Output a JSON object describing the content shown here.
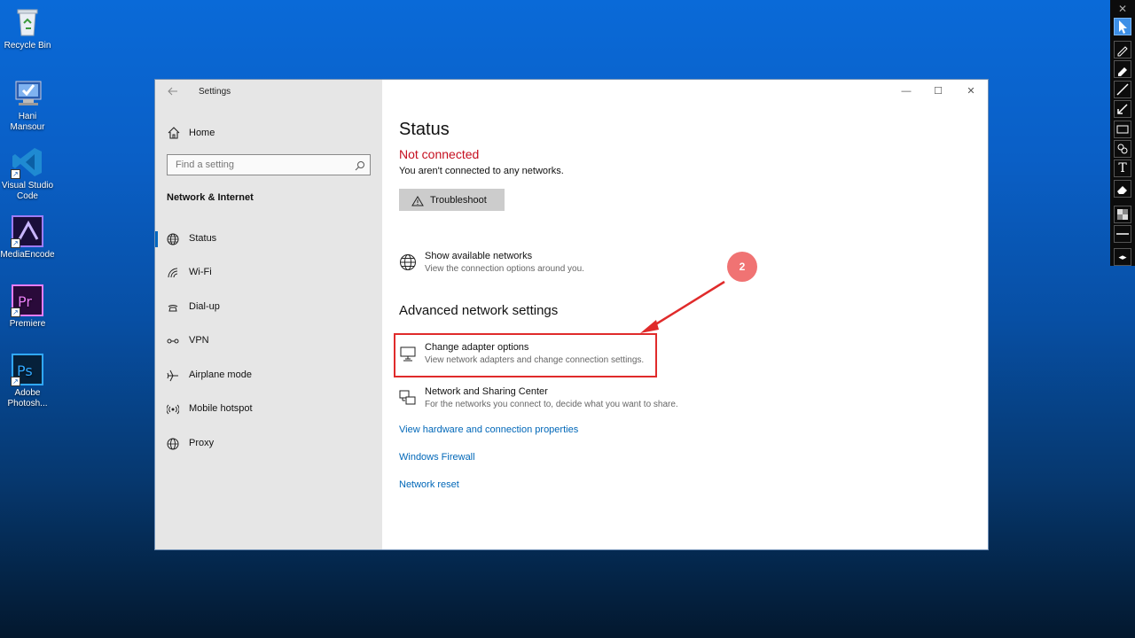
{
  "desktop": {
    "icons": [
      {
        "label": "Recycle Bin",
        "icon": "recycle-bin-icon"
      },
      {
        "label": "Hani Mansour",
        "icon": "user-computer-icon"
      },
      {
        "label": "Visual Studio Code",
        "icon": "vscode-icon"
      },
      {
        "label": "MediaEncode",
        "icon": "media-encoder-icon"
      },
      {
        "label": "Premiere",
        "icon": "premiere-icon"
      },
      {
        "label": "Adobe Photosh...",
        "icon": "photoshop-icon"
      }
    ]
  },
  "toolbar": {
    "close": "✕",
    "tools": [
      "cursor-icon",
      "pen-icon",
      "marker-icon",
      "line-icon",
      "arrow-icon",
      "rectangle-icon",
      "stamp-icon",
      "text-icon",
      "eraser-icon",
      "fill-icon",
      "line-width-icon",
      "swap-icon"
    ],
    "text_tool": "T",
    "swap": "◂▸"
  },
  "window": {
    "title": "Settings",
    "controls": {
      "minimize": "—",
      "maximize": "☐",
      "close": "✕"
    },
    "home": "Home",
    "search_placeholder": "Find a setting",
    "section": "Network & Internet",
    "nav": [
      {
        "label": "Status",
        "icon": "globe-icon",
        "selected": true
      },
      {
        "label": "Wi-Fi",
        "icon": "wifi-icon"
      },
      {
        "label": "Dial-up",
        "icon": "dialup-icon"
      },
      {
        "label": "VPN",
        "icon": "vpn-icon"
      },
      {
        "label": "Airplane mode",
        "icon": "airplane-icon"
      },
      {
        "label": "Mobile hotspot",
        "icon": "hotspot-icon"
      },
      {
        "label": "Proxy",
        "icon": "proxy-globe-icon"
      }
    ]
  },
  "main": {
    "heading": "Status",
    "connection_state": "Not connected",
    "connection_detail": "You aren't connected to any networks.",
    "troubleshoot": "Troubleshoot",
    "show_networks": {
      "title": "Show available networks",
      "desc": "View the connection options around you."
    },
    "advanced_heading": "Advanced network settings",
    "adapter": {
      "title": "Change adapter options",
      "desc": "View network adapters and change connection settings."
    },
    "sharing": {
      "title": "Network and Sharing Center",
      "desc": "For the networks you connect to, decide what you want to share."
    },
    "links": [
      "View hardware and connection properties",
      "Windows Firewall",
      "Network reset"
    ]
  },
  "annotation": {
    "badge": "2",
    "color": "#e02b2b"
  }
}
